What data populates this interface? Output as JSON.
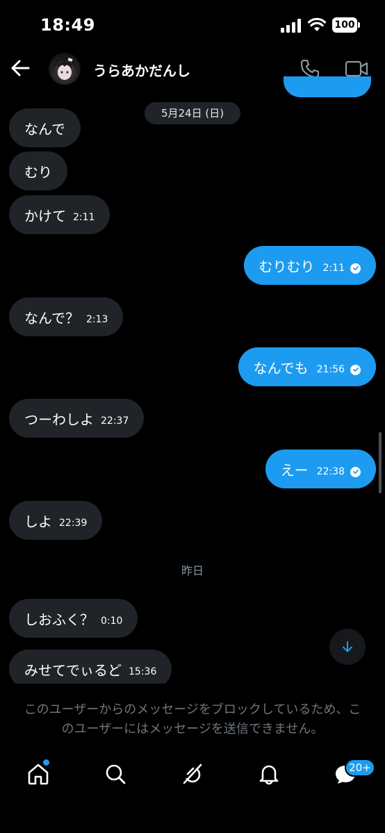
{
  "status_bar": {
    "time": "18:49",
    "battery": "100"
  },
  "header": {
    "contact_name": "うらあかだんし"
  },
  "date_separator": "5月24日 (日)",
  "yesterday_separator": "昨日",
  "messages": [
    {
      "direction": "in",
      "text": "なんで",
      "time": ""
    },
    {
      "direction": "in",
      "text": "むり",
      "time": ""
    },
    {
      "direction": "in",
      "text": "かけて",
      "time": "2:11"
    },
    {
      "direction": "out",
      "text": "むりむり",
      "time": "2:11",
      "read": true
    },
    {
      "direction": "in",
      "text": "なんで？",
      "time": "2:13"
    },
    {
      "direction": "out",
      "text": "なんでも",
      "time": "21:56",
      "read": true
    },
    {
      "direction": "in",
      "text": "つーわしよ",
      "time": "22:37"
    },
    {
      "direction": "out",
      "text": "えー",
      "time": "22:38",
      "read": true
    },
    {
      "direction": "in",
      "text": "しよ",
      "time": "22:39"
    },
    {
      "direction": "in",
      "text": "しおふく？",
      "time": "0:10"
    },
    {
      "direction": "in",
      "text": "みせてでぃるど",
      "time": "15:36"
    }
  ],
  "block_notice": "このユーザーからのメッセージをブロックしているため、このユーザーにはメッセージを送信できません。",
  "nav": {
    "messages_badge": "20+"
  },
  "colors": {
    "accent": "#1d9bf0",
    "incoming_bubble": "#202327",
    "background": "#000000",
    "muted_text": "#6e767d"
  },
  "icons": {
    "back": "arrow-left-icon",
    "call": "phone-icon",
    "video": "video-camera-icon",
    "scroll_down": "arrow-down-icon",
    "home": "home-icon",
    "search": "search-icon",
    "grok": "grok-icon",
    "notifications": "bell-icon",
    "messages": "chat-icon"
  }
}
